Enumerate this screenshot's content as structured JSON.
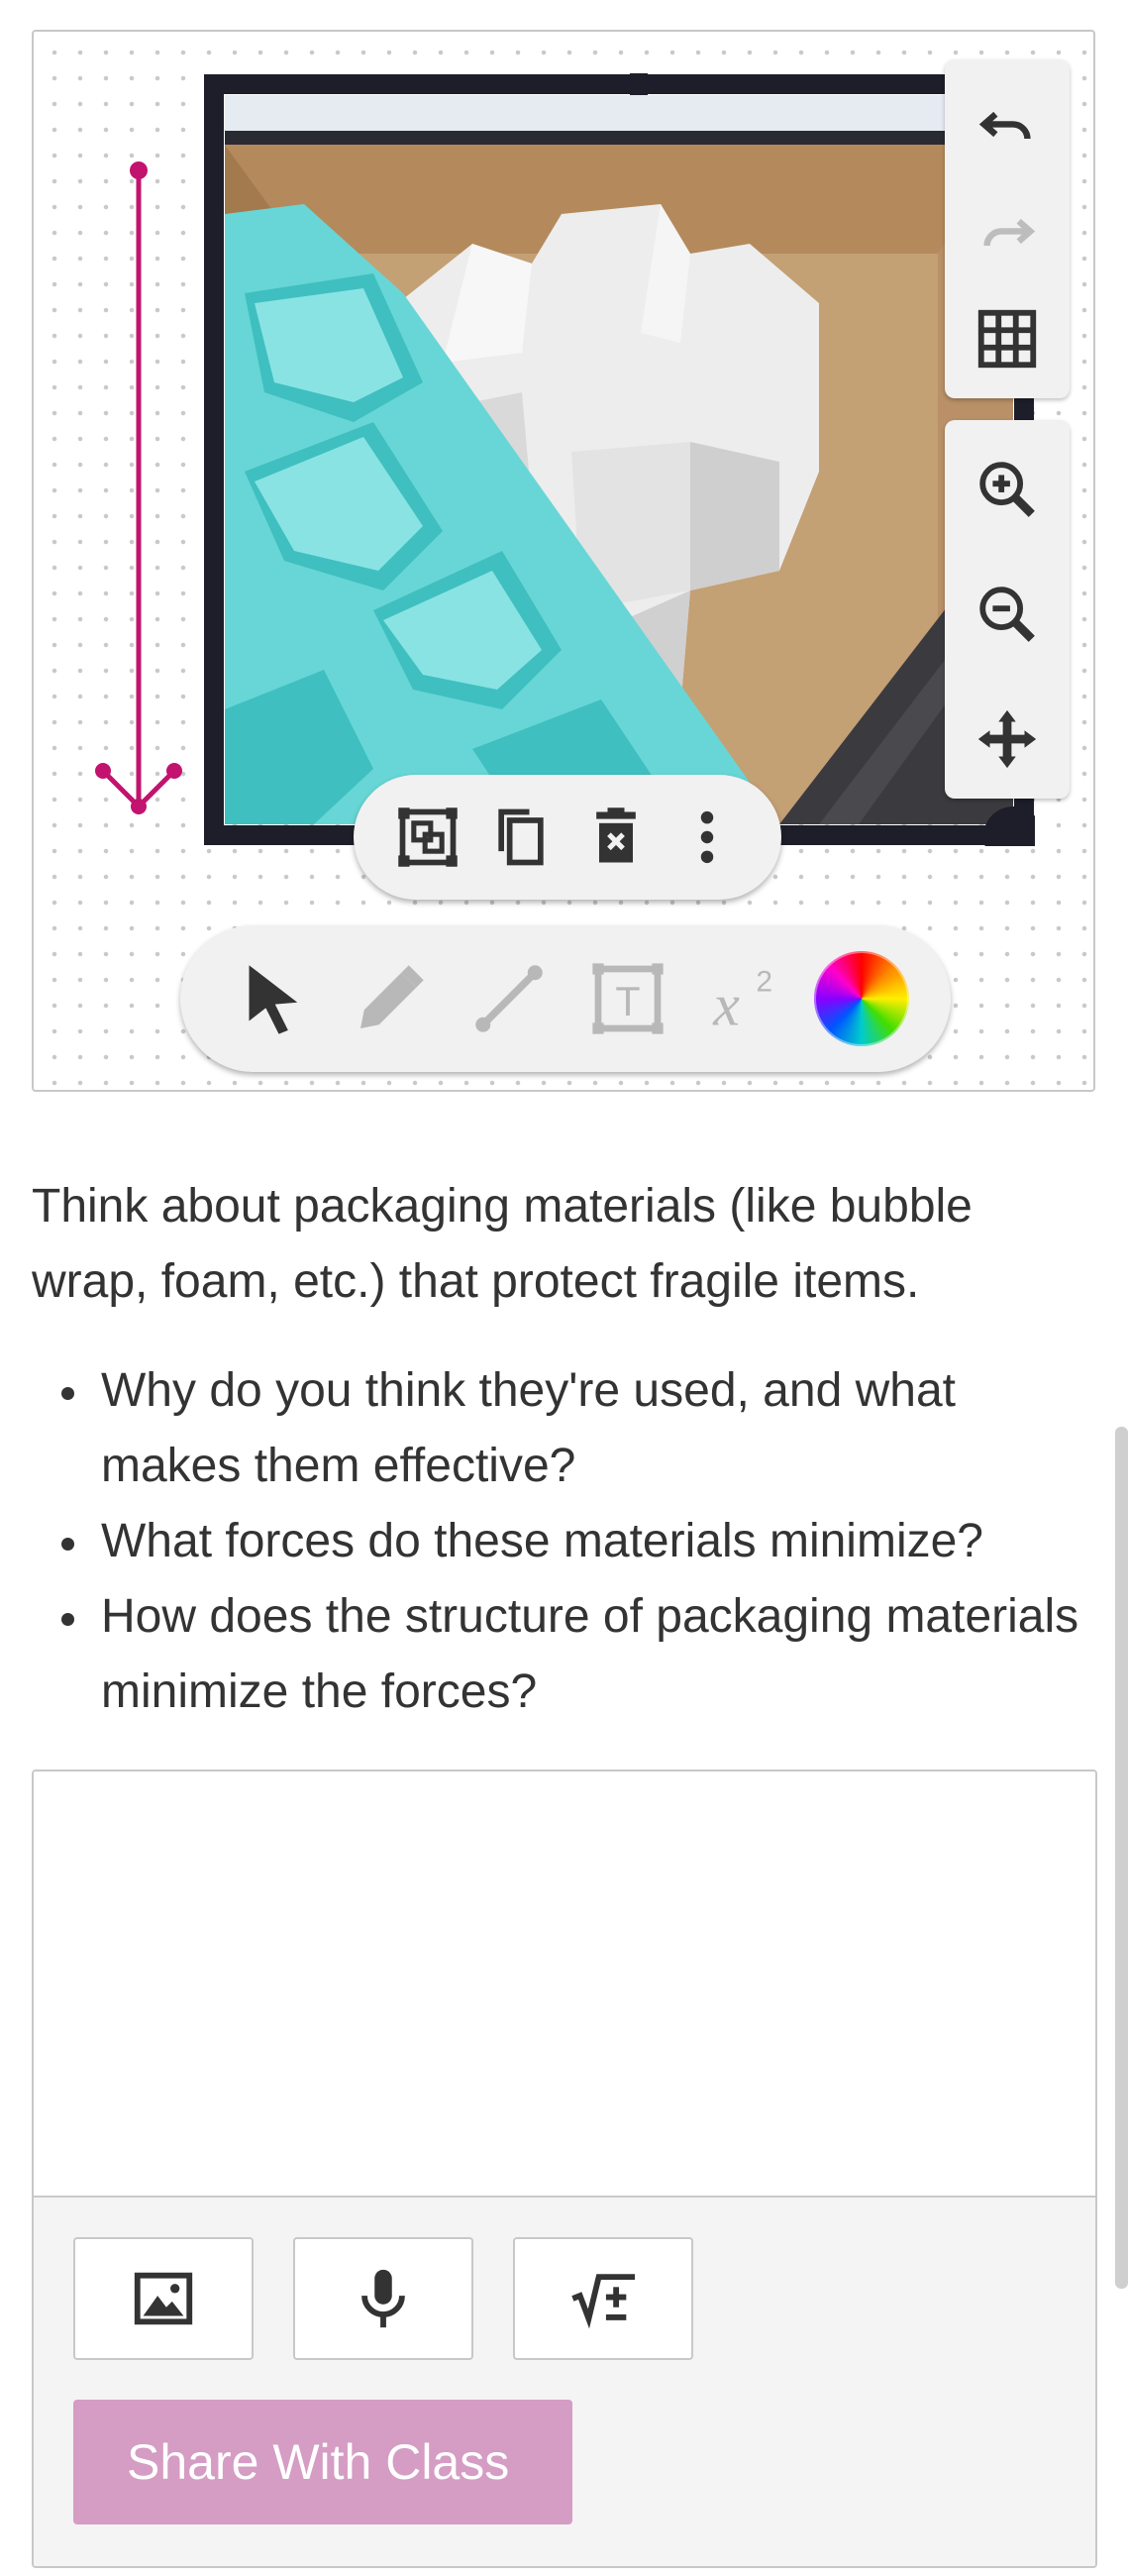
{
  "canvas": {
    "icons": {
      "undo": "undo-icon",
      "redo": "redo-icon",
      "grid": "grid-icon",
      "zoom_in": "zoom-in-icon",
      "zoom_out": "zoom-out-icon",
      "pan": "move-icon"
    },
    "selection_toolbar": [
      "group-icon",
      "duplicate-icon",
      "delete-icon",
      "more-vertical-icon"
    ],
    "draw_toolbar": [
      "select-arrow-icon",
      "pencil-icon",
      "line-icon",
      "text-icon",
      "superscript-icon",
      "color-wheel-icon"
    ],
    "superscript_label": "x",
    "superscript_exp": "2",
    "text_tool_letter": "T",
    "arrow_color": "#c2136e",
    "frame_color": "#1e1e2a"
  },
  "prompt": {
    "intro": "Think about packaging materials (like bubble wrap, foam, etc.) that protect fragile items.",
    "bullets": [
      "Why do you think they're used, and what makes them effective?",
      "What forces do these materials minimize?",
      "How does the structure of packaging materials minimize the forces?"
    ]
  },
  "answer": {
    "attach_icons": [
      "image-icon",
      "microphone-icon",
      "math-icon"
    ],
    "share_label": "Share With Class",
    "share_color": "#d59cc4"
  }
}
